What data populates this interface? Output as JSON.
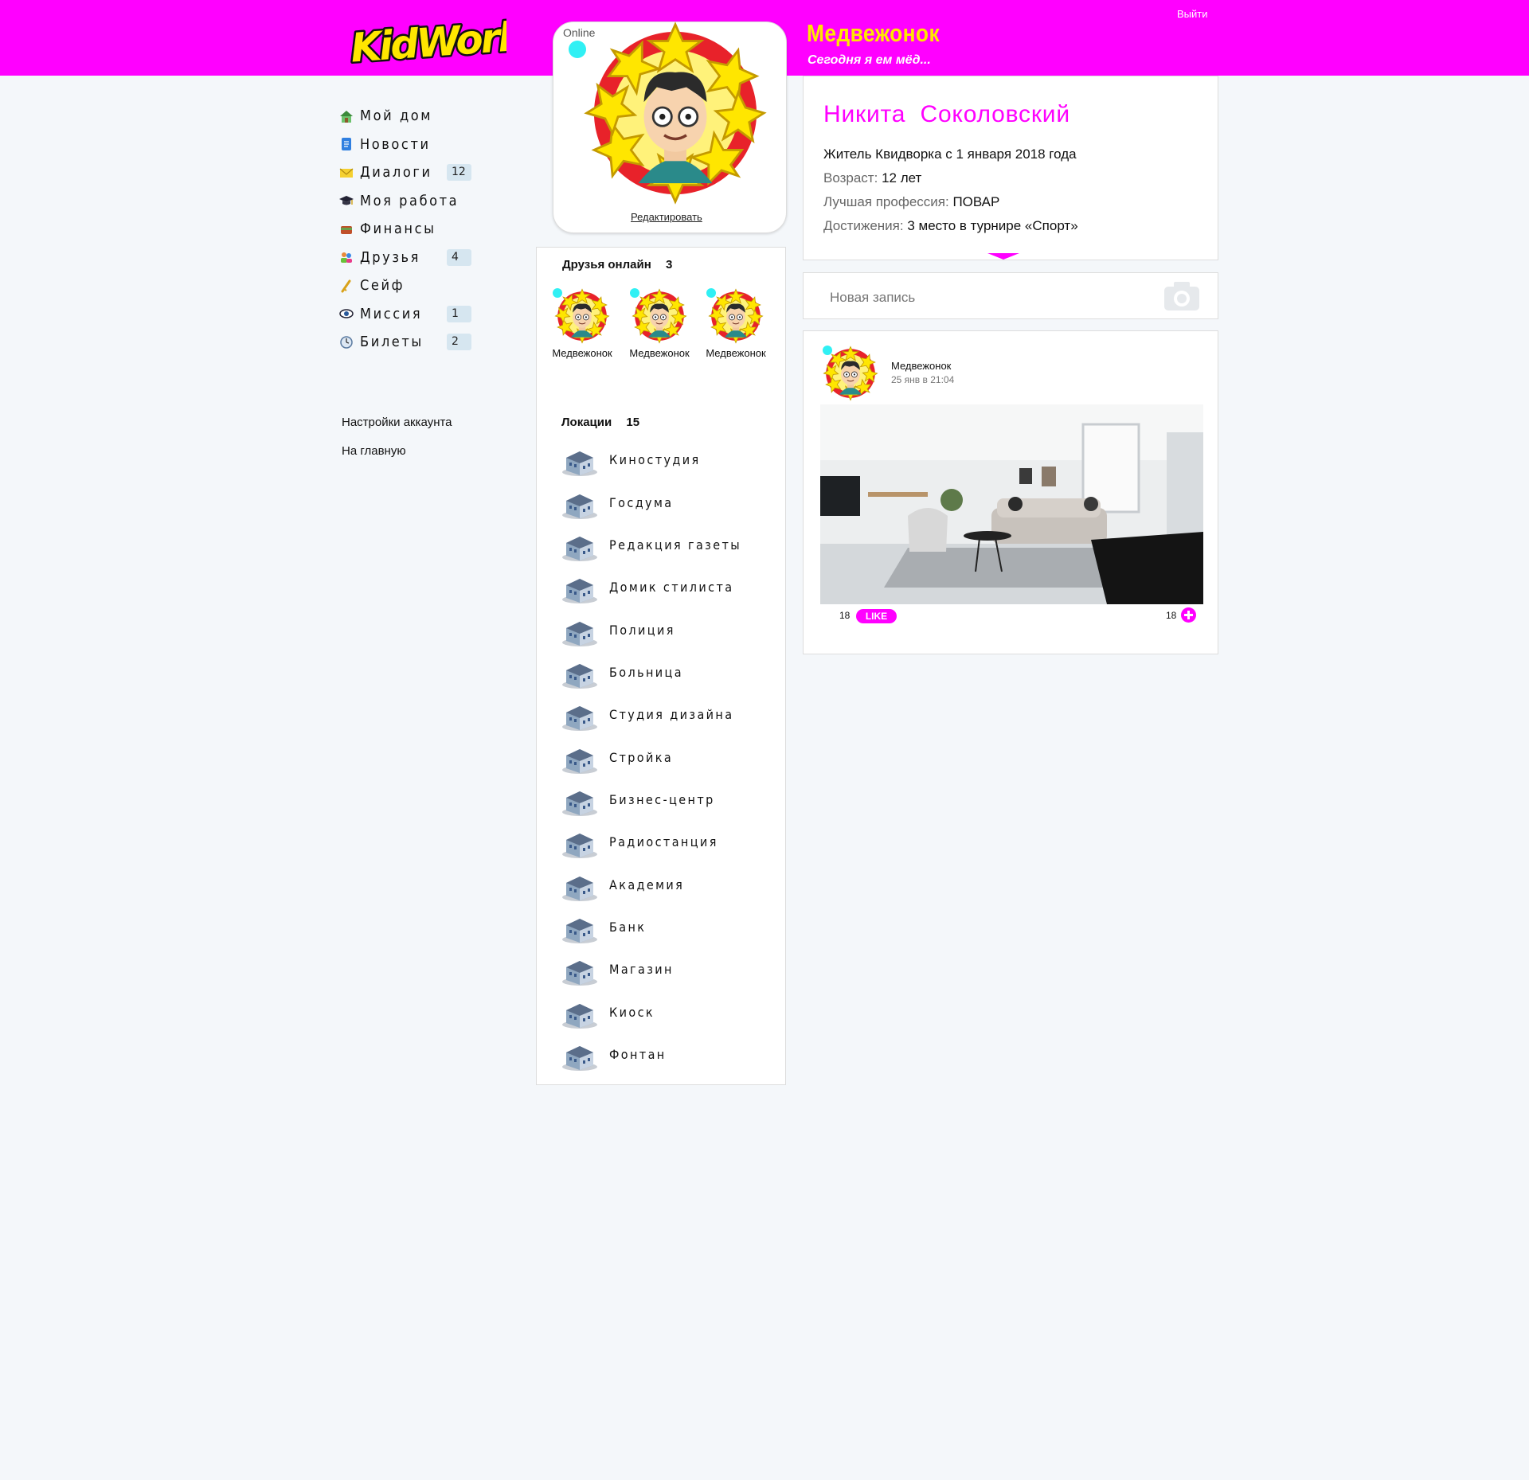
{
  "app": {
    "logo_text": "KidWork",
    "brand_color": "#ff00ff",
    "accent_yellow": "#ffe600",
    "online_color": "#30f0f4"
  },
  "header": {
    "logout_label": "Выйти",
    "nickname": "Медвежонок",
    "status_text": "Сегодня я ем мёд..."
  },
  "avatar_card": {
    "online_label": "Online",
    "edit_label": "Редактировать"
  },
  "nav": {
    "items": [
      {
        "label": "Мой дом",
        "icon": "house-icon",
        "badge": ""
      },
      {
        "label": "Новости",
        "icon": "document-icon",
        "badge": ""
      },
      {
        "label": "Диалоги",
        "icon": "envelope-icon",
        "badge": "12"
      },
      {
        "label": "Моя работа",
        "icon": "graduation-cap-icon",
        "badge": ""
      },
      {
        "label": "Финансы",
        "icon": "wallet-icon",
        "badge": ""
      },
      {
        "label": "Друзья",
        "icon": "friends-icon",
        "badge": "4"
      },
      {
        "label": "Сейф",
        "icon": "key-icon",
        "badge": ""
      },
      {
        "label": "Миссия",
        "icon": "eye-icon",
        "badge": "1"
      },
      {
        "label": "Билеты",
        "icon": "clock-icon",
        "badge": "2"
      }
    ],
    "account_settings": "Настройки аккаунта",
    "home_link": "На главную"
  },
  "friends": {
    "title": "Друзья онлайн",
    "count": "3",
    "list": [
      {
        "name": "Медвежонок"
      },
      {
        "name": "Медвежонок"
      },
      {
        "name": "Медвежонок"
      }
    ]
  },
  "locations": {
    "title": "Локации",
    "count": "15",
    "items": [
      {
        "label": "Киностудия",
        "icon": "film-studio-icon"
      },
      {
        "label": "Госдума",
        "icon": "parliament-icon"
      },
      {
        "label": "Редакция газеты",
        "icon": "newspaper-office-icon"
      },
      {
        "label": "Домик стилиста",
        "icon": "stylist-house-icon"
      },
      {
        "label": "Полиция",
        "icon": "police-station-icon"
      },
      {
        "label": "Больница",
        "icon": "hospital-icon"
      },
      {
        "label": "Студия дизайна",
        "icon": "design-studio-icon"
      },
      {
        "label": "Стройка",
        "icon": "construction-site-icon"
      },
      {
        "label": "Бизнес-центр",
        "icon": "business-center-icon"
      },
      {
        "label": "Радиостанция",
        "icon": "radio-tower-icon"
      },
      {
        "label": "Академия",
        "icon": "academy-icon"
      },
      {
        "label": "Банк",
        "icon": "bank-icon"
      },
      {
        "label": "Магазин",
        "icon": "shop-icon"
      },
      {
        "label": "Киоск",
        "icon": "kiosk-icon"
      },
      {
        "label": "Фонтан",
        "icon": "fountain-icon"
      }
    ]
  },
  "profile": {
    "first_name": "Никита",
    "last_name": "Соколовский",
    "resident_since": "Житель Квидворка с 1 января 2018 года",
    "age_key": "Возраст:",
    "age_value": "12 лет",
    "profession_key": "Лучшая профессия:",
    "profession_value": "ПОВАР",
    "achievements_key": "Достижения:",
    "achievements_value": "3 место в турнире «Спорт»"
  },
  "new_post": {
    "placeholder": "Новая запись"
  },
  "post": {
    "author": "Медвежонок",
    "date": "25 янв в 21:04",
    "likes": "18",
    "like_label": "LIKE",
    "shares": "18"
  }
}
